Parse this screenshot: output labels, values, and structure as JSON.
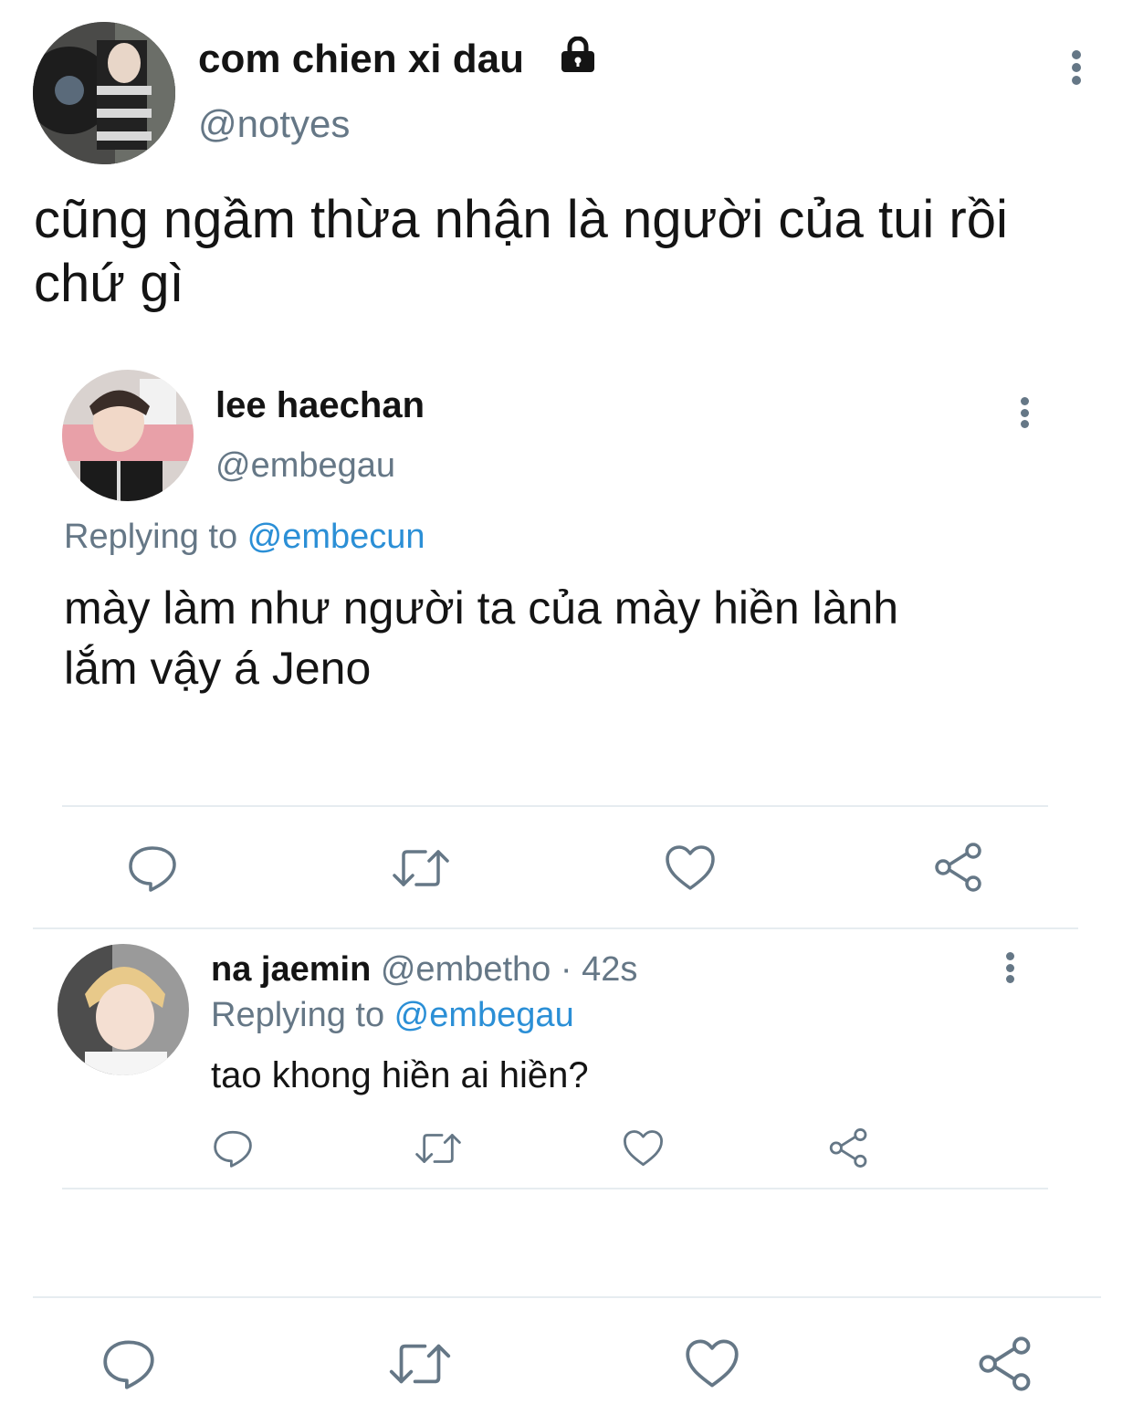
{
  "main_tweet": {
    "display_name": "com chien xi dau",
    "handle": "@notyes",
    "protected_icon": "lock-icon",
    "text_line1": "cũng ngầm thừa nhận là người của tui rồi",
    "text_line2": "chứ gì"
  },
  "quoted_tweet": {
    "display_name": "lee haechan",
    "handle": "@embegau",
    "replying_prefix": "Replying to ",
    "replying_to": "@embecun",
    "text_line1": "mày làm như người ta của mày hiền lành",
    "text_line2": "lắm vậy á Jeno",
    "actions": [
      "reply-icon",
      "retweet-icon",
      "like-icon",
      "share-icon"
    ]
  },
  "reply_tweet": {
    "display_name": "na jaemin",
    "handle": "@embetho",
    "separator": "·",
    "time": "42s",
    "replying_prefix": "Replying to ",
    "replying_to": "@embegau",
    "text": "tao khong hiền ai hiền?",
    "actions": [
      "reply-icon",
      "retweet-icon",
      "like-icon",
      "share-icon"
    ]
  },
  "bottom_actions": [
    "reply-icon",
    "retweet-icon",
    "like-icon",
    "share-icon"
  ],
  "colors": {
    "text": "#141414",
    "secondary": "#657786",
    "link": "#2b8fd6",
    "divider": "#e6ecf0"
  }
}
